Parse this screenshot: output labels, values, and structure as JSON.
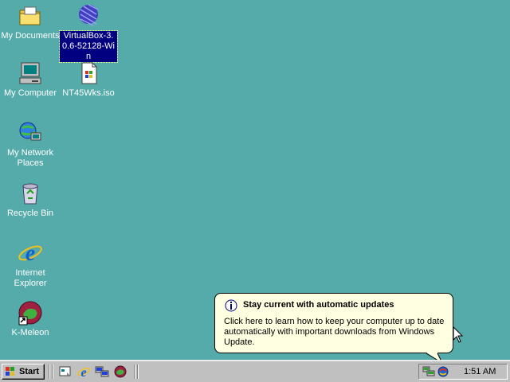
{
  "desktop": {
    "icons": [
      {
        "label": "My Documents"
      },
      {
        "label": "VirtualBox-3.0.6-52128-Win"
      },
      {
        "label": "My Computer"
      },
      {
        "label": "NT45Wks.iso"
      },
      {
        "label": "My Network Places"
      },
      {
        "label": "Recycle Bin"
      },
      {
        "label": "Internet Explorer"
      },
      {
        "label": "K-Meleon"
      }
    ],
    "background_color": "#55aaaa",
    "selection_color": "#000080"
  },
  "balloon": {
    "title": "Stay current with automatic updates",
    "body": "Click here to learn how to keep your computer up to date automatically with important downloads from Windows Update.",
    "icon": "info-icon"
  },
  "taskbar": {
    "start_label": "Start",
    "quick_launch": [
      "show-desktop-icon",
      "internet-explorer-icon",
      "network-icon",
      "k-meleon-icon"
    ],
    "tray_icons": [
      "network-connection-icon",
      "automatic-updates-icon"
    ],
    "clock": "1:51 AM"
  }
}
